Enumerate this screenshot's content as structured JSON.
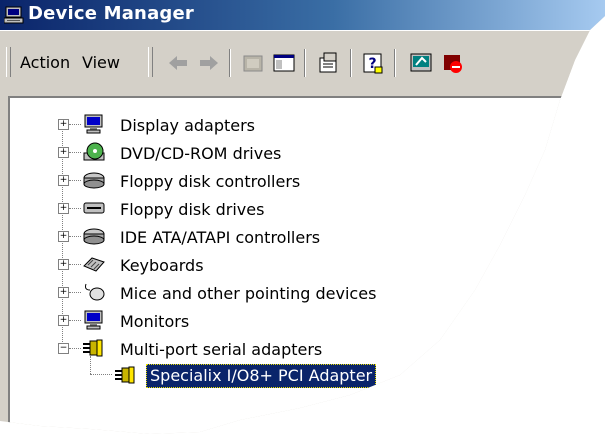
{
  "window": {
    "title": "Device Manager"
  },
  "menu": {
    "action": "Action",
    "view": "View"
  },
  "toolbar": {
    "icons": [
      "back-arrow-icon",
      "forward-arrow-icon",
      "up-level-icon",
      "show-hide-tree-icon",
      "properties-icon",
      "help-icon",
      "scan-hardware-icon",
      "disable-device-icon"
    ]
  },
  "tree": {
    "categories": [
      {
        "label": "Display adapters",
        "icon": "monitor-icon",
        "expanded": false
      },
      {
        "label": "DVD/CD-ROM drives",
        "icon": "cd-drive-icon",
        "expanded": false
      },
      {
        "label": "Floppy disk controllers",
        "icon": "controller-icon",
        "expanded": false
      },
      {
        "label": "Floppy disk drives",
        "icon": "floppy-drive-icon",
        "expanded": false
      },
      {
        "label": "IDE ATA/ATAPI controllers",
        "icon": "controller-icon",
        "expanded": false
      },
      {
        "label": "Keyboards",
        "icon": "keyboard-icon",
        "expanded": false
      },
      {
        "label": "Mice and other pointing devices",
        "icon": "mouse-icon",
        "expanded": false
      },
      {
        "label": "Monitors",
        "icon": "monitor-icon",
        "expanded": false
      },
      {
        "label": "Multi-port serial adapters",
        "icon": "serial-adapter-icon",
        "expanded": true
      }
    ],
    "child": {
      "label": "Specialix I/O8+ PCI Adapter",
      "icon": "serial-adapter-icon",
      "selected": true
    }
  },
  "colors": {
    "title_gradient_start": "#0a246a",
    "title_gradient_end": "#a6caf0",
    "selection": "#0a246a",
    "face": "#d4d0c8"
  }
}
